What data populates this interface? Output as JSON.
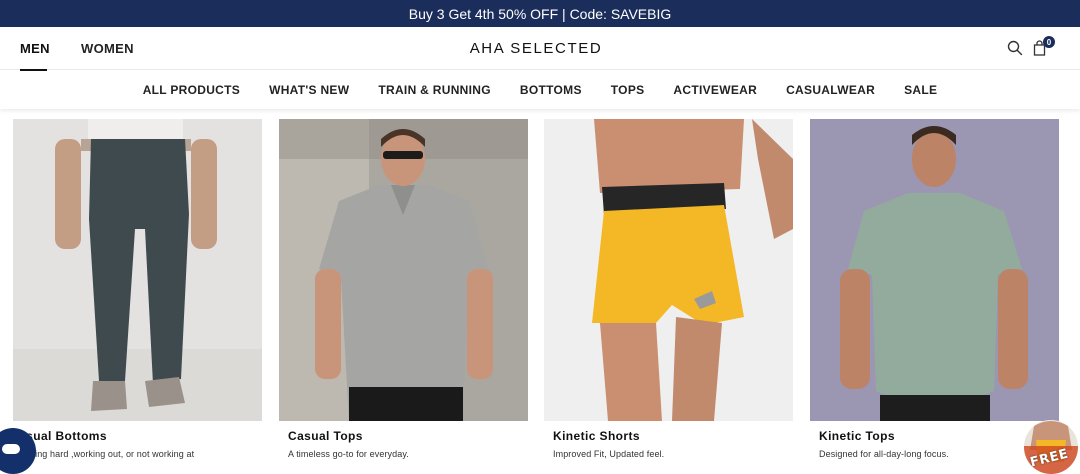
{
  "promo": {
    "text": "Buy 3 Get 4th 50% OFF | Code: SAVEBIG"
  },
  "header": {
    "tabs": [
      {
        "label": "MEN",
        "active": true
      },
      {
        "label": "WOMEN",
        "active": false
      }
    ],
    "logo": "AHA SELECTED",
    "icons": {
      "search": "search-icon",
      "cart": "bag-icon"
    },
    "cart_count": "0"
  },
  "nav": {
    "items": [
      "ALL PRODUCTS",
      "WHAT'S NEW",
      "TRAIN & RUNNING",
      "BOTTOMS",
      "TOPS",
      "ACTIVEWEAR",
      "CASUALWEAR",
      "SALE"
    ]
  },
  "products": [
    {
      "title": "Casual Bottoms",
      "desc": "r working hard ,working out, or not working at"
    },
    {
      "title": "Casual Tops",
      "desc": "A timeless go-to for everyday."
    },
    {
      "title": "Kinetic Shorts",
      "desc": "Improved Fit, Updated feel."
    },
    {
      "title": "Kinetic Tops",
      "desc": "Designed for all-day-long focus."
    }
  ],
  "widgets": {
    "free_badge": "FREE",
    "chat": "chat-icon"
  },
  "colors": {
    "promo_bg": "#1b2d5a",
    "accent": "#1b2d5a"
  }
}
